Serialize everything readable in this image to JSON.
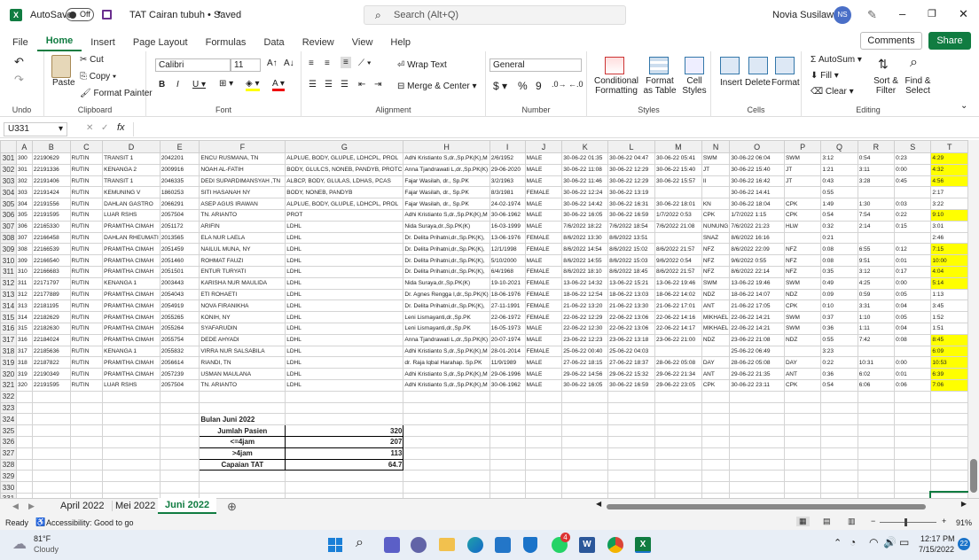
{
  "title": {
    "autosave_label": "AutoSave",
    "autosave_state": "Off",
    "doc": "TAT Cairan tubuh • Saved",
    "search_placeholder": "Search (Alt+Q)",
    "user": "Novia Susilawati",
    "initials": "NS"
  },
  "ribbon_tabs": [
    "File",
    "Home",
    "Insert",
    "Page Layout",
    "Formulas",
    "Data",
    "Review",
    "View",
    "Help"
  ],
  "comments_label": "Comments",
  "share_label": "Share",
  "ribbon": {
    "undo_group": "Undo",
    "clipboard_group": "Clipboard",
    "paste": "Paste",
    "cut": "Cut",
    "copy": "Copy",
    "format_painter": "Format Painter",
    "font_group": "Font",
    "font_name": "Calibri",
    "font_size": "11",
    "alignment_group": "Alignment",
    "wrap_text": "Wrap Text",
    "merge_center": "Merge & Center",
    "number_group": "Number",
    "number_format": "General",
    "styles_group": "Styles",
    "conditional": "Conditional Formatting",
    "format_table": "Format as Table",
    "cell_styles": "Cell Styles",
    "cells_group": "Cells",
    "insert": "Insert",
    "delete": "Delete",
    "format": "Format",
    "editing_group": "Editing",
    "autosum": "AutoSum",
    "fill": "Fill",
    "clear": "Clear",
    "sort_filter": "Sort & Filter",
    "find_select": "Find & Select"
  },
  "formula": {
    "name_box": "U331",
    "fx": "fx",
    "value": ""
  },
  "columns": [
    "A",
    "B",
    "C",
    "D",
    "E",
    "F",
    "G",
    "H",
    "I",
    "J",
    "K",
    "L",
    "M",
    "N",
    "O",
    "P",
    "Q",
    "R",
    "S",
    "T"
  ],
  "rows": [
    {
      "r": "301",
      "c": [
        "300",
        "22190629",
        "RUTIN",
        "TRANSIT 1",
        "2042201",
        "ENCU RUSMANA, TN",
        "ALPLUE, BODY, GLUPLE, LDHCPL, PROL",
        "Adhi Kristianto S,dr.,Sp.PK(K),M",
        "2/6/1952",
        "MALE",
        "30-06-22 01:35",
        "30-06-22 04:47",
        "30-06-22 05:41",
        "SWM",
        "30-06-22 06:04",
        "SWM",
        "3:12",
        "0:54",
        "0:23",
        "4:29"
      ],
      "y": true
    },
    {
      "r": "302",
      "c": [
        "301",
        "22191336",
        "RUTIN",
        "KENANGA 2",
        "2009916",
        "NOAH AL-FATIH",
        "BODY, GLULCS, NONEB, PANDYB, PROTC",
        "Anna Tjandrawati L,dr.,Sp.PK(K)",
        "29-06-2020",
        "MALE",
        "30-06-22 11:08",
        "30-06-22 12:29",
        "30-06-22 15:40",
        "JT",
        "30-06-22 15:40",
        "JT",
        "1:21",
        "3:11",
        "0:00",
        "4:32"
      ],
      "y": true
    },
    {
      "r": "303",
      "c": [
        "302",
        "22191406",
        "RUTIN",
        "TRANSIT 1",
        "2046335",
        "DEDI SUPARDIMANSYAH ,TN",
        "ALBCP, BODY, GLULAS, LDHAS, PCAS",
        "Fajar Wasilah, dr., Sp.PK",
        "3/2/1963",
        "MALE",
        "30-06-22 11:46",
        "30-06-22 12:29",
        "30-06-22 15:57",
        "II",
        "30-06-22 16:42",
        "JT",
        "0:43",
        "3:28",
        "0:45",
        "4:56"
      ],
      "y": true
    },
    {
      "r": "304",
      "c": [
        "303",
        "22191424",
        "RUTIN",
        "KEMUNING V",
        "1860253",
        "SITI HASANAH NY",
        "BODY, NONEB, PANDYB",
        "Fajar Wasilah, dr., Sp.PK",
        "8/3/1981",
        "FEMALE",
        "30-06-22 12:24",
        "30-06-22 13:19",
        "",
        "",
        "30-06-22 14:41",
        "",
        "0:55",
        "",
        "",
        "2:17"
      ],
      "y": false
    },
    {
      "r": "305",
      "c": [
        "304",
        "22191556",
        "RUTIN",
        "DAHLAN GASTRO",
        "2066291",
        "ASEP AGUS IRAWAN",
        "ALPLUE, BODY, GLUPLE, LDHCPL, PROL",
        "Fajar Wasilah, dr., Sp.PK",
        "24-02-1974",
        "MALE",
        "30-06-22 14:42",
        "30-06-22 16:31",
        "30-06-22 18:01",
        "KN",
        "30-06-22 18:04",
        "CPK",
        "1:49",
        "1:30",
        "0:03",
        "3:22"
      ],
      "y": false
    },
    {
      "r": "306",
      "c": [
        "305",
        "22191595",
        "RUTIN",
        "LUAR RSHS",
        "2057504",
        "TN. ARIANTO",
        "PROT",
        "Adhi Kristianto S,dr.,Sp.PK(K),M",
        "30-06-1962",
        "MALE",
        "30-06-22 16:05",
        "30-06-22 16:59",
        "1/7/2022 0:53",
        "CPK",
        "1/7/2022 1:15",
        "CPK",
        "0:54",
        "7:54",
        "0:22",
        "9:10"
      ],
      "y": true
    },
    {
      "r": "307",
      "c": [
        "306",
        "22165330",
        "RUTIN",
        "PRAMITHA CIMAH",
        "2051172",
        "ARIFIN",
        "LDHL",
        "Nida Suraya,dr.,Sp.PK(K)",
        "16-03-1999",
        "MALE",
        "7/6/2022 18:22",
        "7/6/2022 18:54",
        "7/6/2022 21:08",
        "NUNUNG",
        "7/6/2022 21:23",
        "HLW",
        "0:32",
        "2:14",
        "0:15",
        "3:01"
      ],
      "y": false
    },
    {
      "r": "308",
      "c": [
        "307",
        "22166458",
        "RUTIN",
        "DAHLAN RHEUMATI",
        "2013565",
        "ELA NUR LAELA",
        "LDHL",
        "Dr. Delita Prihatni,dr.,Sp.PK(K),",
        "13-06-1976",
        "FEMALE",
        "8/6/2022 13:30",
        "8/6/2022 13:51",
        "",
        "SNAZ",
        "8/6/2022 16:16",
        "",
        "0:21",
        "",
        "",
        "2:46"
      ],
      "y": false
    },
    {
      "r": "309",
      "c": [
        "308",
        "22166539",
        "RUTIN",
        "PRAMITHA CIMAH",
        "2051459",
        "NAILUL MUNA, NY",
        "LDHL",
        "Dr. Delita Prihatni,dr.,Sp.PK(K),",
        "12/1/1998",
        "FEMALE",
        "8/6/2022 14:54",
        "8/6/2022 15:02",
        "8/6/2022 21:57",
        "NFZ",
        "8/6/2022 22:09",
        "NFZ",
        "0:08",
        "6:55",
        "0:12",
        "7:15"
      ],
      "y": true
    },
    {
      "r": "310",
      "c": [
        "309",
        "22166540",
        "RUTIN",
        "PRAMITHA CIMAH",
        "2051460",
        "ROHMAT FAUZI",
        "LDHL",
        "Dr. Delita Prihatni,dr.,Sp.PK(K),",
        "5/10/2000",
        "MALE",
        "8/6/2022 14:55",
        "8/6/2022 15:03",
        "9/6/2022 0:54",
        "NFZ",
        "9/6/2022 0:55",
        "NFZ",
        "0:08",
        "9:51",
        "0:01",
        "10:00"
      ],
      "y": true
    },
    {
      "r": "311",
      "c": [
        "310",
        "22166683",
        "RUTIN",
        "PRAMITHA CIMAH",
        "2051501",
        "ENTUR TURYATI",
        "LDHL",
        "Dr. Delita Prihatni,dr.,Sp.PK(K),",
        "6/4/1968",
        "FEMALE",
        "8/6/2022 18:10",
        "8/6/2022 18:45",
        "8/6/2022 21:57",
        "NFZ",
        "8/6/2022 22:14",
        "NFZ",
        "0:35",
        "3:12",
        "0:17",
        "4:04"
      ],
      "y": true
    },
    {
      "r": "312",
      "c": [
        "311",
        "22171797",
        "RUTIN",
        "KENANGA 1",
        "2003443",
        "KARISHA NUR MAULIDA",
        "LDHL",
        "Nida Suraya,dr.,Sp.PK(K)",
        "19-10-2021",
        "FEMALE",
        "13-06-22 14:32",
        "13-06-22 15:21",
        "13-06-22 19:46",
        "SWM",
        "13-06-22 19:46",
        "SWM",
        "0:49",
        "4:25",
        "0:00",
        "5:14"
      ],
      "y": true
    },
    {
      "r": "313",
      "c": [
        "312",
        "22177889",
        "RUTIN",
        "PRAMITHA CIMAH",
        "2054043",
        "ETI ROHAETI",
        "LDHL",
        "Dr. Agnes Rengga I,dr.,Sp.PK(K)",
        "18-06-1976",
        "FEMALE",
        "18-06-22 12:54",
        "18-06-22 13:03",
        "18-06-22 14:02",
        "NDZ",
        "18-06-22 14:07",
        "NDZ",
        "0:09",
        "0:59",
        "0:05",
        "1:13"
      ],
      "y": false
    },
    {
      "r": "314",
      "c": [
        "313",
        "22181195",
        "RUTIN",
        "PRAMITHA CIMAH",
        "2054919",
        "NOVA FIRANIKHA",
        "LDHL",
        "Dr. Delita Prihatni,dr.,Sp.PK(K),",
        "27-11-1991",
        "FEMALE",
        "21-06-22 13:20",
        "21-06-22 13:30",
        "21-06-22 17:01",
        "ANT",
        "21-06-22 17:05",
        "CPK",
        "0:10",
        "3:31",
        "0:04",
        "3:45"
      ],
      "y": false
    },
    {
      "r": "315",
      "c": [
        "314",
        "22182629",
        "RUTIN",
        "PRAMITHA CIMAH",
        "2055265",
        "KONIH, NY",
        "LDHL",
        "Leni Lismayanti,dr.,Sp.PK",
        "22-06-1972",
        "FEMALE",
        "22-06-22 12:29",
        "22-06-22 13:06",
        "22-06-22 14:16",
        "MIKHAEL",
        "22-06-22 14:21",
        "SWM",
        "0:37",
        "1:10",
        "0:05",
        "1:52"
      ],
      "y": false
    },
    {
      "r": "316",
      "c": [
        "315",
        "22182630",
        "RUTIN",
        "PRAMITHA CIMAH",
        "2055264",
        "SYAFARUDIN",
        "LDHL",
        "Leni Lismayanti,dr.,Sp.PK",
        "16-05-1973",
        "MALE",
        "22-06-22 12:30",
        "22-06-22 13:06",
        "22-06-22 14:17",
        "MIKHAEL",
        "22-06-22 14:21",
        "SWM",
        "0:36",
        "1:11",
        "0:04",
        "1:51"
      ],
      "y": false
    },
    {
      "r": "317",
      "c": [
        "316",
        "22184024",
        "RUTIN",
        "PRAMITHA CIMAH",
        "2055754",
        "DEDE AHYADI",
        "LDHL",
        "Anna Tjandrawati L,dr.,Sp.PK(K)",
        "20-07-1974",
        "MALE",
        "23-06-22 12:23",
        "23-06-22 13:18",
        "23-06-22 21:00",
        "NDZ",
        "23-06-22 21:08",
        "NDZ",
        "0:55",
        "7:42",
        "0:08",
        "8:45"
      ],
      "y": true
    },
    {
      "r": "318",
      "c": [
        "317",
        "22185636",
        "RUTIN",
        "KENANGA 1",
        "2055832",
        "VIRRA NUR SALSABILA",
        "LDHL",
        "Adhi Kristianto S,dr.,Sp.PK(K),M",
        "28-01-2014",
        "FEMALE",
        "25-06-22 00:40",
        "25-06-22 04:03",
        "",
        "",
        "25-06-22 06:49",
        "",
        "3:23",
        "",
        "",
        "6:09"
      ],
      "y": true
    },
    {
      "r": "319",
      "c": [
        "318",
        "22187822",
        "RUTIN",
        "PRAMITHA CIMAH",
        "2056614",
        "RIANDI, TN",
        "LDHL",
        "dr. Raja Iqbal Harahap. Sp.PK",
        "11/9/1989",
        "MALE",
        "27-06-22 18:15",
        "27-06-22 18:37",
        "28-06-22 05:08",
        "DAY",
        "28-06-22 05:08",
        "DAY",
        "0:22",
        "10:31",
        "0:00",
        "10:53"
      ],
      "y": true
    },
    {
      "r": "320",
      "c": [
        "319",
        "22190349",
        "RUTIN",
        "PRAMITHA CIMAH",
        "2057239",
        "USMAN MAULANA",
        "LDHL",
        "Adhi Kristianto S,dr.,Sp.PK(K),M",
        "29-06-1996",
        "MALE",
        "29-06-22 14:56",
        "29-06-22 15:32",
        "29-06-22 21:34",
        "ANT",
        "29-06-22 21:35",
        "ANT",
        "0:36",
        "6:02",
        "0:01",
        "6:39"
      ],
      "y": true
    },
    {
      "r": "321",
      "c": [
        "320",
        "22191595",
        "RUTIN",
        "LUAR RSHS",
        "2057504",
        "TN. ARIANTO",
        "LDHL",
        "Adhi Kristianto S,dr.,Sp.PK(K),M",
        "30-06-1962",
        "MALE",
        "30-06-22 16:05",
        "30-06-22 16:59",
        "29-06-22 23:05",
        "CPK",
        "30-06-22 23:11",
        "CPK",
        "0:54",
        "6:06",
        "0:06",
        "7:06"
      ],
      "y": true
    }
  ],
  "empty_rows": [
    "322",
    "323"
  ],
  "summary": {
    "row_title": "324",
    "title": "Bulan Juni 2022",
    "items": [
      {
        "r": "325",
        "label": "Jumlah Pasien",
        "value": "320"
      },
      {
        "r": "326",
        "label": "<=4jam",
        "value": "207"
      },
      {
        "r": "327",
        "label": ">4jam",
        "value": "113"
      },
      {
        "r": "328",
        "label": "Capaian TAT",
        "value": "64.7"
      }
    ]
  },
  "tail_rows": [
    "329",
    "330",
    "331"
  ],
  "sheets": [
    "April 2022",
    "Mei 2022",
    "Juni 2022"
  ],
  "status": {
    "ready": "Ready",
    "accessibility": "Accessibility: Good to go",
    "zoom": "91%"
  },
  "weather": {
    "temp": "81°F",
    "desc": "Cloudy"
  },
  "clock": {
    "time": "12:17 PM",
    "date": "7/15/2022"
  },
  "notif": "22",
  "badge": "4",
  "colors": {
    "excel_green": "#107c41",
    "highlight": "#ffff00"
  }
}
